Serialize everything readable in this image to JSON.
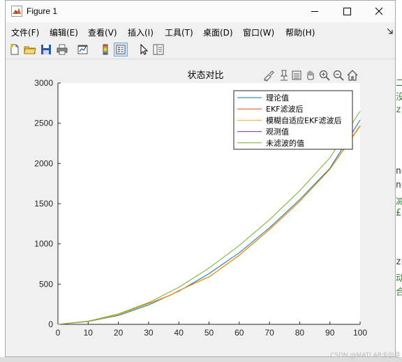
{
  "window": {
    "title": "Figure 1"
  },
  "menu": [
    "文件(F)",
    "编辑(E)",
    "查看(V)",
    "插入(I)",
    "工具(T)",
    "桌面(D)",
    "窗口(W)",
    "帮助(H)"
  ],
  "toolbar": [
    "new-figure",
    "open-file",
    "save",
    "print",
    "link-plot",
    "insert-colorbar",
    "insert-legend",
    "edit-plot",
    "property-inspector"
  ],
  "axes_toolbar": [
    "brush",
    "data-tips",
    "rotate",
    "pan",
    "zoom-in",
    "zoom-out",
    "restore-view"
  ],
  "chart_data": {
    "type": "line",
    "title": "状态对比",
    "xlabel": "",
    "ylabel": "",
    "xlim": [
      0,
      100
    ],
    "ylim": [
      0,
      3000
    ],
    "xticks": [
      0,
      10,
      20,
      30,
      40,
      50,
      60,
      70,
      80,
      90,
      100
    ],
    "yticks": [
      0,
      500,
      1000,
      1500,
      2000,
      2500,
      3000
    ],
    "grid": false,
    "legend_position": "top-right",
    "series": [
      {
        "name": "理论值",
        "color": "#0072BD",
        "x": [
          0,
          10,
          20,
          30,
          40,
          50,
          60,
          70,
          80,
          90,
          100
        ],
        "y": [
          0,
          35,
          110,
          240,
          410,
          630,
          890,
          1200,
          1550,
          1940,
          2540
        ]
      },
      {
        "name": "EKF滤波后",
        "color": "#D95319",
        "x": [
          0,
          10,
          20,
          30,
          37,
          40,
          48,
          50,
          60,
          70,
          80,
          90,
          100
        ],
        "y": [
          0,
          38,
          120,
          260,
          360,
          420,
          560,
          590,
          860,
          1180,
          1530,
          1930,
          2470
        ]
      },
      {
        "name": "模糊自适应EKF滤波后",
        "color": "#EDB120",
        "x": [
          0,
          10,
          20,
          30,
          37,
          40,
          48,
          50,
          60,
          70,
          80,
          90,
          100
        ],
        "y": [
          0,
          36,
          118,
          255,
          355,
          415,
          555,
          585,
          855,
          1175,
          1525,
          1925,
          2460
        ]
      },
      {
        "name": "观测值",
        "color": "#7E2F8E",
        "x": [],
        "y": []
      },
      {
        "name": "未滤波的值",
        "color": "#77AC30",
        "x": [
          0,
          10,
          20,
          30,
          40,
          50,
          60,
          70,
          80,
          90,
          100
        ],
        "y": [
          0,
          40,
          130,
          270,
          460,
          700,
          980,
          1300,
          1660,
          2070,
          2650
        ]
      }
    ]
  },
  "watermark": "CSDN @MATLAB卡尔曼"
}
